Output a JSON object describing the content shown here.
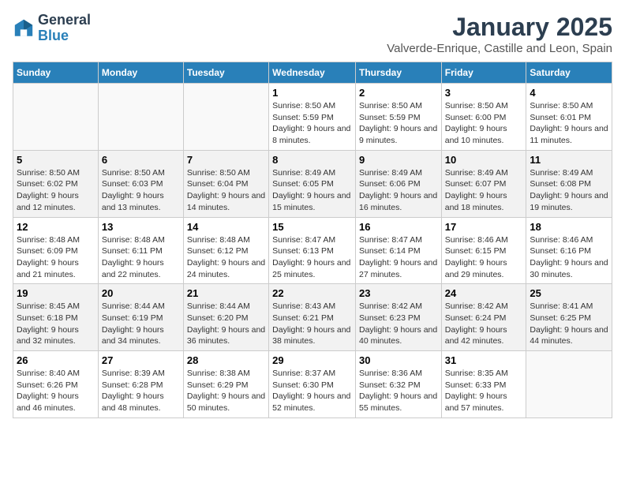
{
  "header": {
    "logo_line1": "General",
    "logo_line2": "Blue",
    "month": "January 2025",
    "location": "Valverde-Enrique, Castille and Leon, Spain"
  },
  "weekdays": [
    "Sunday",
    "Monday",
    "Tuesday",
    "Wednesday",
    "Thursday",
    "Friday",
    "Saturday"
  ],
  "weeks": [
    [
      {
        "day": "",
        "info": ""
      },
      {
        "day": "",
        "info": ""
      },
      {
        "day": "",
        "info": ""
      },
      {
        "day": "1",
        "info": "Sunrise: 8:50 AM\nSunset: 5:59 PM\nDaylight: 9 hours and 8 minutes."
      },
      {
        "day": "2",
        "info": "Sunrise: 8:50 AM\nSunset: 5:59 PM\nDaylight: 9 hours and 9 minutes."
      },
      {
        "day": "3",
        "info": "Sunrise: 8:50 AM\nSunset: 6:00 PM\nDaylight: 9 hours and 10 minutes."
      },
      {
        "day": "4",
        "info": "Sunrise: 8:50 AM\nSunset: 6:01 PM\nDaylight: 9 hours and 11 minutes."
      }
    ],
    [
      {
        "day": "5",
        "info": "Sunrise: 8:50 AM\nSunset: 6:02 PM\nDaylight: 9 hours and 12 minutes."
      },
      {
        "day": "6",
        "info": "Sunrise: 8:50 AM\nSunset: 6:03 PM\nDaylight: 9 hours and 13 minutes."
      },
      {
        "day": "7",
        "info": "Sunrise: 8:50 AM\nSunset: 6:04 PM\nDaylight: 9 hours and 14 minutes."
      },
      {
        "day": "8",
        "info": "Sunrise: 8:49 AM\nSunset: 6:05 PM\nDaylight: 9 hours and 15 minutes."
      },
      {
        "day": "9",
        "info": "Sunrise: 8:49 AM\nSunset: 6:06 PM\nDaylight: 9 hours and 16 minutes."
      },
      {
        "day": "10",
        "info": "Sunrise: 8:49 AM\nSunset: 6:07 PM\nDaylight: 9 hours and 18 minutes."
      },
      {
        "day": "11",
        "info": "Sunrise: 8:49 AM\nSunset: 6:08 PM\nDaylight: 9 hours and 19 minutes."
      }
    ],
    [
      {
        "day": "12",
        "info": "Sunrise: 8:48 AM\nSunset: 6:09 PM\nDaylight: 9 hours and 21 minutes."
      },
      {
        "day": "13",
        "info": "Sunrise: 8:48 AM\nSunset: 6:11 PM\nDaylight: 9 hours and 22 minutes."
      },
      {
        "day": "14",
        "info": "Sunrise: 8:48 AM\nSunset: 6:12 PM\nDaylight: 9 hours and 24 minutes."
      },
      {
        "day": "15",
        "info": "Sunrise: 8:47 AM\nSunset: 6:13 PM\nDaylight: 9 hours and 25 minutes."
      },
      {
        "day": "16",
        "info": "Sunrise: 8:47 AM\nSunset: 6:14 PM\nDaylight: 9 hours and 27 minutes."
      },
      {
        "day": "17",
        "info": "Sunrise: 8:46 AM\nSunset: 6:15 PM\nDaylight: 9 hours and 29 minutes."
      },
      {
        "day": "18",
        "info": "Sunrise: 8:46 AM\nSunset: 6:16 PM\nDaylight: 9 hours and 30 minutes."
      }
    ],
    [
      {
        "day": "19",
        "info": "Sunrise: 8:45 AM\nSunset: 6:18 PM\nDaylight: 9 hours and 32 minutes."
      },
      {
        "day": "20",
        "info": "Sunrise: 8:44 AM\nSunset: 6:19 PM\nDaylight: 9 hours and 34 minutes."
      },
      {
        "day": "21",
        "info": "Sunrise: 8:44 AM\nSunset: 6:20 PM\nDaylight: 9 hours and 36 minutes."
      },
      {
        "day": "22",
        "info": "Sunrise: 8:43 AM\nSunset: 6:21 PM\nDaylight: 9 hours and 38 minutes."
      },
      {
        "day": "23",
        "info": "Sunrise: 8:42 AM\nSunset: 6:23 PM\nDaylight: 9 hours and 40 minutes."
      },
      {
        "day": "24",
        "info": "Sunrise: 8:42 AM\nSunset: 6:24 PM\nDaylight: 9 hours and 42 minutes."
      },
      {
        "day": "25",
        "info": "Sunrise: 8:41 AM\nSunset: 6:25 PM\nDaylight: 9 hours and 44 minutes."
      }
    ],
    [
      {
        "day": "26",
        "info": "Sunrise: 8:40 AM\nSunset: 6:26 PM\nDaylight: 9 hours and 46 minutes."
      },
      {
        "day": "27",
        "info": "Sunrise: 8:39 AM\nSunset: 6:28 PM\nDaylight: 9 hours and 48 minutes."
      },
      {
        "day": "28",
        "info": "Sunrise: 8:38 AM\nSunset: 6:29 PM\nDaylight: 9 hours and 50 minutes."
      },
      {
        "day": "29",
        "info": "Sunrise: 8:37 AM\nSunset: 6:30 PM\nDaylight: 9 hours and 52 minutes."
      },
      {
        "day": "30",
        "info": "Sunrise: 8:36 AM\nSunset: 6:32 PM\nDaylight: 9 hours and 55 minutes."
      },
      {
        "day": "31",
        "info": "Sunrise: 8:35 AM\nSunset: 6:33 PM\nDaylight: 9 hours and 57 minutes."
      },
      {
        "day": "",
        "info": ""
      }
    ]
  ]
}
